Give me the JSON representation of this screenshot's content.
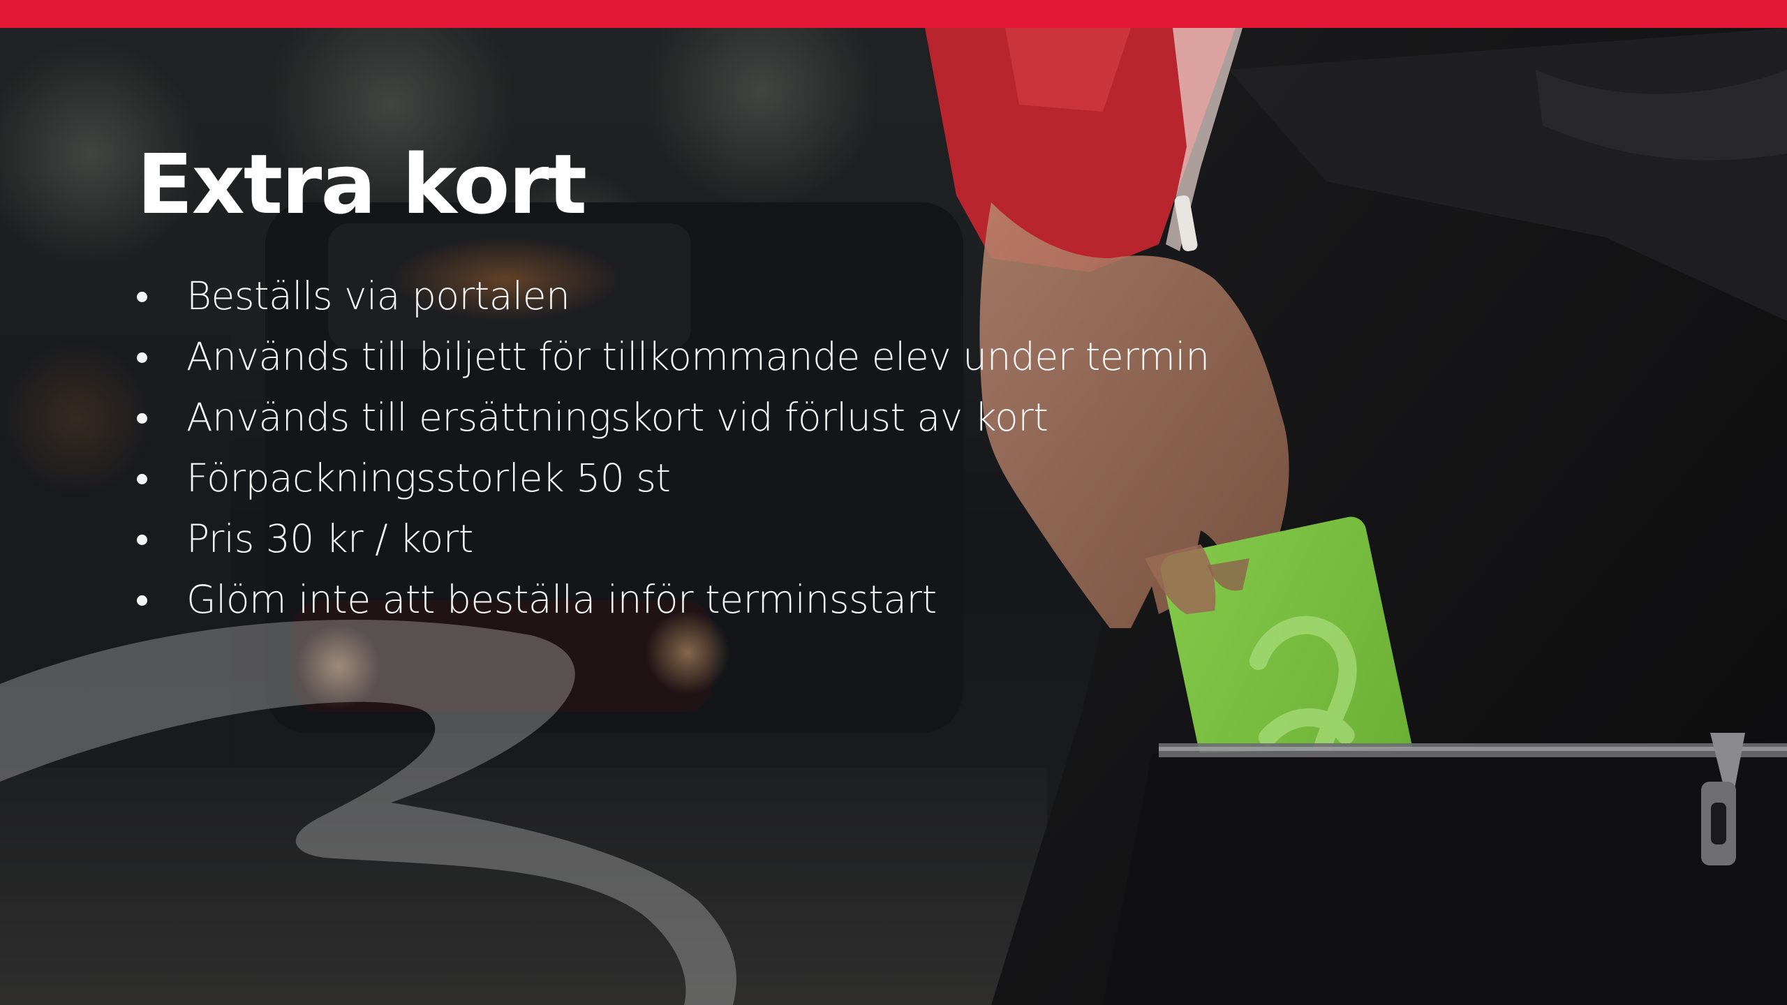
{
  "slide": {
    "title": "Extra kort",
    "bullets": [
      "Beställs via portalen",
      "Används till biljett för tillkommande elev under termin",
      "Används till ersättningskort vid förlust av kort",
      "Förpackningsstorlek 50 st",
      "Pris 30 kr / kort",
      "Glöm inte att beställa inför terminsstart"
    ]
  },
  "colors": {
    "brand_red": "#e31837",
    "card_green": "#7cc242",
    "text": "#ffffff",
    "background": "#141416"
  },
  "icons": {
    "background_photo": "hand-inserting-travel-card-photo",
    "brand_swirl": "brand-swirl-logo",
    "card_logo": "card-swirl-logo"
  }
}
